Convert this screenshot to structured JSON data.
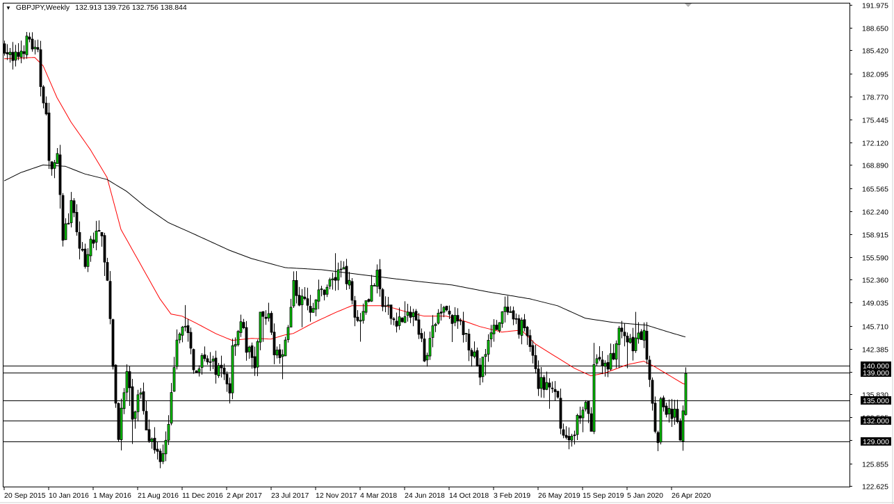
{
  "header": {
    "symbol": "GBPJPY,Weekly",
    "ohlc": "132.913 139.726 132.756 138.844"
  },
  "chart_data": {
    "type": "candlestick",
    "title": "GBPJPY,Weekly",
    "last_bar": {
      "open": 132.913,
      "high": 139.726,
      "low": 132.756,
      "close": 138.844
    },
    "ylim": [
      122.625,
      191.975
    ],
    "weeks": 246,
    "yticks": [
      "191.975",
      "188.650",
      "185.420",
      "182.095",
      "178.770",
      "175.445",
      "172.120",
      "168.890",
      "165.565",
      "162.240",
      "158.915",
      "155.590",
      "152.360",
      "149.035",
      "145.710",
      "142.385",
      "139.060",
      "135.830",
      "132.505",
      "129.280",
      "125.855",
      "122.625"
    ],
    "xticks": [
      {
        "week": 0,
        "label": "20 Sep 2015"
      },
      {
        "week": 16,
        "label": "10 Jan 2016"
      },
      {
        "week": 32,
        "label": "1 May 2016"
      },
      {
        "week": 48,
        "label": "21 Aug 2016"
      },
      {
        "week": 64,
        "label": "11 Dec 2016"
      },
      {
        "week": 80,
        "label": "2 Apr 2017"
      },
      {
        "week": 96,
        "label": "23 Jul 2017"
      },
      {
        "week": 112,
        "label": "12 Nov 2017"
      },
      {
        "week": 128,
        "label": "4 Mar 2018"
      },
      {
        "week": 144,
        "label": "24 Jun 2018"
      },
      {
        "week": 160,
        "label": "14 Oct 2018"
      },
      {
        "week": 176,
        "label": "3 Feb 2019"
      },
      {
        "week": 192,
        "label": "26 May 2019"
      },
      {
        "week": 208,
        "label": "15 Sep 2019"
      },
      {
        "week": 224,
        "label": "5 Jan 2020"
      },
      {
        "week": 240,
        "label": "26 Apr 2020"
      }
    ],
    "horizontal_levels": [
      {
        "price": 140.0,
        "label": "140.000"
      },
      {
        "price": 139.0,
        "label": "139.000"
      },
      {
        "price": 135.0,
        "label": "135.000"
      },
      {
        "price": 132.0,
        "label": "132.000"
      },
      {
        "price": 129.0,
        "label": "129.000"
      }
    ],
    "close_path": [
      [
        0,
        186.2
      ],
      [
        3,
        183.5
      ],
      [
        6,
        185.5
      ],
      [
        9,
        187.0
      ],
      [
        11,
        185.0
      ],
      [
        12,
        184.5
      ],
      [
        13,
        180.6
      ],
      [
        15,
        177.1
      ],
      [
        16,
        168.6
      ],
      [
        19,
        169.6
      ],
      [
        20,
        163.6
      ],
      [
        21,
        158.6
      ],
      [
        24,
        162.6
      ],
      [
        26,
        159.6
      ],
      [
        29,
        153.6
      ],
      [
        31,
        157.6
      ],
      [
        35,
        159.6
      ],
      [
        37,
        151.6
      ],
      [
        39,
        139.6
      ],
      [
        40,
        134.6
      ],
      [
        41,
        130.5
      ],
      [
        44,
        138.6
      ],
      [
        46,
        132.6
      ],
      [
        49,
        136.6
      ],
      [
        51,
        131.6
      ],
      [
        54,
        127.6
      ],
      [
        57,
        127.0
      ],
      [
        59,
        130.5
      ],
      [
        61,
        140.6
      ],
      [
        64,
        146.6
      ],
      [
        66,
        143.6
      ],
      [
        69,
        138.6
      ],
      [
        71,
        142.6
      ],
      [
        74,
        140.1
      ],
      [
        79,
        138.6
      ],
      [
        81,
        136.6
      ],
      [
        82,
        142.6
      ],
      [
        85,
        146.6
      ],
      [
        87,
        142.6
      ],
      [
        90,
        140.1
      ],
      [
        92,
        146.6
      ],
      [
        95,
        146.6
      ],
      [
        97,
        142.6
      ],
      [
        100,
        140.6
      ],
      [
        104,
        151.6
      ],
      [
        106,
        149.6
      ],
      [
        110,
        148.6
      ],
      [
        114,
        150.6
      ],
      [
        116,
        151.6
      ],
      [
        119,
        152.6
      ],
      [
        122,
        154.6
      ],
      [
        125,
        149.6
      ],
      [
        127,
        146.6
      ],
      [
        130,
        149.6
      ],
      [
        134,
        152.6
      ],
      [
        136,
        148.6
      ],
      [
        140,
        146.6
      ],
      [
        144,
        146.6
      ],
      [
        147,
        147.6
      ],
      [
        151,
        141.6
      ],
      [
        154,
        144.6
      ],
      [
        157,
        148.6
      ],
      [
        161,
        146.6
      ],
      [
        165,
        145.1
      ],
      [
        169,
        141.6
      ],
      [
        171,
        138.6
      ],
      [
        174,
        143.6
      ],
      [
        177,
        145.6
      ],
      [
        180,
        147.6
      ],
      [
        184,
        145.6
      ],
      [
        187,
        145.6
      ],
      [
        190,
        141.6
      ],
      [
        192,
        137.6
      ],
      [
        196,
        136.6
      ],
      [
        199,
        134.6
      ],
      [
        201,
        129.6
      ],
      [
        204,
        129.1
      ],
      [
        206,
        132.6
      ],
      [
        209,
        133.6
      ],
      [
        211,
        131.6
      ],
      [
        212,
        140.6
      ],
      [
        216,
        140.1
      ],
      [
        219,
        141.6
      ],
      [
        221,
        145.6
      ],
      [
        224,
        142.6
      ],
      [
        227,
        143.6
      ],
      [
        230,
        144.6
      ],
      [
        232,
        138.6
      ],
      [
        234,
        131.6
      ],
      [
        235,
        129.6
      ],
      [
        236,
        134.6
      ],
      [
        239,
        133.6
      ],
      [
        241,
        132.6
      ],
      [
        243,
        129.6
      ],
      [
        244,
        132.9
      ],
      [
        245,
        138.844
      ]
    ],
    "series": [
      {
        "name": "MA fast",
        "color": "#ff0000",
        "values": [
          [
            0,
            184.2
          ],
          [
            11,
            184.4
          ],
          [
            14,
            183.2
          ],
          [
            19,
            178.6
          ],
          [
            24,
            175.1
          ],
          [
            31,
            171.1
          ],
          [
            37,
            167.1
          ],
          [
            42,
            159.6
          ],
          [
            49,
            154.6
          ],
          [
            56,
            149.6
          ],
          [
            60,
            147.4
          ],
          [
            64,
            147.1
          ],
          [
            69,
            146.1
          ],
          [
            76,
            144.6
          ],
          [
            82,
            143.6
          ],
          [
            89,
            143.9
          ],
          [
            96,
            143.8
          ],
          [
            101,
            144.4
          ],
          [
            104,
            144.6
          ],
          [
            111,
            146.1
          ],
          [
            119,
            147.6
          ],
          [
            125,
            148.6
          ],
          [
            132,
            148.6
          ],
          [
            137,
            148.6
          ],
          [
            144,
            147.8
          ],
          [
            151,
            147.1
          ],
          [
            159,
            147.1
          ],
          [
            164,
            146.6
          ],
          [
            171,
            145.6
          ],
          [
            179,
            144.8
          ],
          [
            186,
            145.1
          ],
          [
            191,
            143.1
          ],
          [
            199,
            141.1
          ],
          [
            205,
            139.6
          ],
          [
            211,
            138.5
          ],
          [
            216,
            138.9
          ],
          [
            224,
            140.1
          ],
          [
            230,
            140.6
          ],
          [
            234,
            139.8
          ],
          [
            239,
            138.6
          ],
          [
            244,
            137.4
          ],
          [
            245,
            137.3
          ]
        ]
      },
      {
        "name": "MA slow",
        "color": "#000000",
        "values": [
          [
            0,
            166.6
          ],
          [
            6,
            167.8
          ],
          [
            14,
            168.9
          ],
          [
            22,
            168.7
          ],
          [
            29,
            167.6
          ],
          [
            37,
            166.8
          ],
          [
            44,
            165.1
          ],
          [
            51,
            162.8
          ],
          [
            59,
            160.6
          ],
          [
            69,
            158.8
          ],
          [
            81,
            156.6
          ],
          [
            89,
            155.4
          ],
          [
            101,
            154.1
          ],
          [
            114,
            153.8
          ],
          [
            124,
            153.3
          ],
          [
            134,
            152.8
          ],
          [
            149,
            152.1
          ],
          [
            161,
            151.6
          ],
          [
            174,
            150.6
          ],
          [
            189,
            149.6
          ],
          [
            199,
            148.6
          ],
          [
            209,
            146.8
          ],
          [
            219,
            146.2
          ],
          [
            231,
            145.8
          ],
          [
            239,
            144.8
          ],
          [
            245,
            144.1
          ]
        ]
      }
    ],
    "colors": {
      "up": "#00c800",
      "down": "#000000",
      "outline": "#000000",
      "level_label_bg": "#000000",
      "level_label_text": "#ffffff"
    }
  }
}
